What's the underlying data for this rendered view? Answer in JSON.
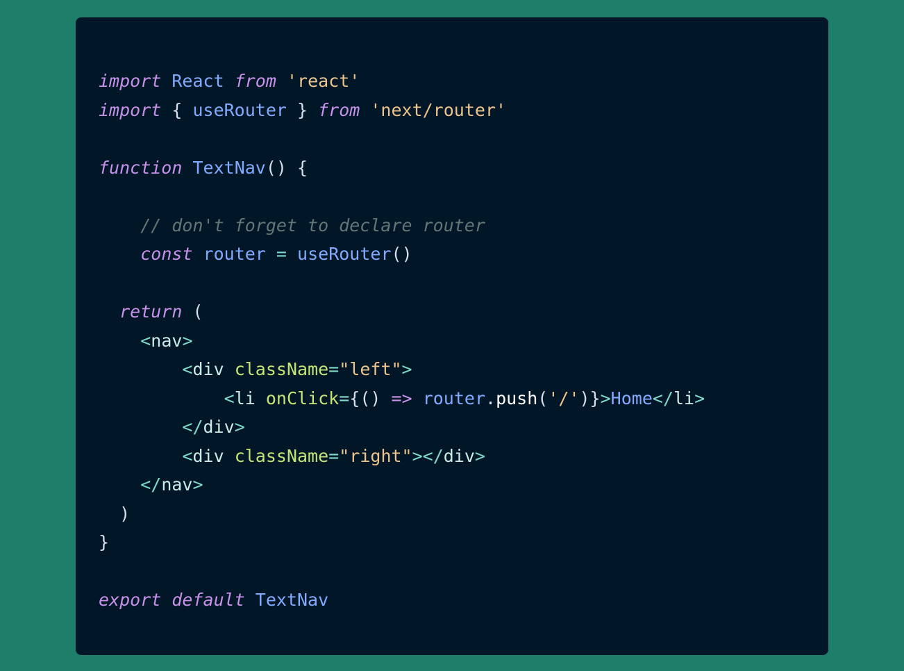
{
  "editor": {
    "lines": [
      {
        "tokens": [
          {
            "text": "import",
            "kind": "keyword"
          },
          {
            "text": " ",
            "kind": "punct"
          },
          {
            "text": "React",
            "kind": "ident"
          },
          {
            "text": " ",
            "kind": "punct"
          },
          {
            "text": "from",
            "kind": "keyword"
          },
          {
            "text": " ",
            "kind": "punct"
          },
          {
            "text": "'react'",
            "kind": "string"
          }
        ]
      },
      {
        "tokens": [
          {
            "text": "import",
            "kind": "keyword"
          },
          {
            "text": " { ",
            "kind": "punct"
          },
          {
            "text": "useRouter",
            "kind": "ident"
          },
          {
            "text": " } ",
            "kind": "punct"
          },
          {
            "text": "from",
            "kind": "keyword"
          },
          {
            "text": " ",
            "kind": "punct"
          },
          {
            "text": "'next/router'",
            "kind": "string"
          }
        ]
      },
      {
        "tokens": []
      },
      {
        "tokens": [
          {
            "text": "function",
            "kind": "keyword"
          },
          {
            "text": " ",
            "kind": "punct"
          },
          {
            "text": "TextNav",
            "kind": "ident"
          },
          {
            "text": "() {",
            "kind": "punct"
          }
        ]
      },
      {
        "tokens": []
      },
      {
        "tokens": [
          {
            "text": "    ",
            "kind": "punct"
          },
          {
            "text": "// don't forget to declare router",
            "kind": "comment"
          }
        ]
      },
      {
        "tokens": [
          {
            "text": "    ",
            "kind": "punct"
          },
          {
            "text": "const",
            "kind": "keyword"
          },
          {
            "text": " ",
            "kind": "punct"
          },
          {
            "text": "router",
            "kind": "ident"
          },
          {
            "text": " ",
            "kind": "punct"
          },
          {
            "text": "=",
            "kind": "tag"
          },
          {
            "text": " ",
            "kind": "punct"
          },
          {
            "text": "useRouter",
            "kind": "ident"
          },
          {
            "text": "()",
            "kind": "punct"
          }
        ]
      },
      {
        "tokens": []
      },
      {
        "tokens": [
          {
            "text": "  ",
            "kind": "punct"
          },
          {
            "text": "return",
            "kind": "keyword"
          },
          {
            "text": " (",
            "kind": "punct"
          }
        ]
      },
      {
        "tokens": [
          {
            "text": "    ",
            "kind": "punct"
          },
          {
            "text": "<",
            "kind": "tag"
          },
          {
            "text": "nav",
            "kind": "tagname"
          },
          {
            "text": ">",
            "kind": "tag"
          }
        ]
      },
      {
        "tokens": [
          {
            "text": "        ",
            "kind": "punct"
          },
          {
            "text": "<",
            "kind": "tag"
          },
          {
            "text": "div",
            "kind": "tagname"
          },
          {
            "text": " ",
            "kind": "punct"
          },
          {
            "text": "className",
            "kind": "attr"
          },
          {
            "text": "=",
            "kind": "tag"
          },
          {
            "text": "\"left\"",
            "kind": "string"
          },
          {
            "text": ">",
            "kind": "tag"
          }
        ]
      },
      {
        "tokens": [
          {
            "text": "            ",
            "kind": "punct"
          },
          {
            "text": "<",
            "kind": "tag"
          },
          {
            "text": "li",
            "kind": "tagname"
          },
          {
            "text": " ",
            "kind": "punct"
          },
          {
            "text": "onClick",
            "kind": "attr"
          },
          {
            "text": "=",
            "kind": "tag"
          },
          {
            "text": "{",
            "kind": "punct"
          },
          {
            "text": "()",
            "kind": "punct"
          },
          {
            "text": " ",
            "kind": "punct"
          },
          {
            "text": "=>",
            "kind": "keyword"
          },
          {
            "text": " ",
            "kind": "punct"
          },
          {
            "text": "router",
            "kind": "ident"
          },
          {
            "text": ".",
            "kind": "punct"
          },
          {
            "text": "push",
            "kind": "prop"
          },
          {
            "text": "(",
            "kind": "punct"
          },
          {
            "text": "'/'",
            "kind": "string"
          },
          {
            "text": ")}",
            "kind": "punct"
          },
          {
            "text": ">",
            "kind": "tag"
          },
          {
            "text": "Home",
            "kind": "text"
          },
          {
            "text": "</",
            "kind": "tag"
          },
          {
            "text": "li",
            "kind": "tagname"
          },
          {
            "text": ">",
            "kind": "tag"
          }
        ]
      },
      {
        "tokens": [
          {
            "text": "        ",
            "kind": "punct"
          },
          {
            "text": "</",
            "kind": "tag"
          },
          {
            "text": "div",
            "kind": "tagname"
          },
          {
            "text": ">",
            "kind": "tag"
          }
        ]
      },
      {
        "tokens": [
          {
            "text": "        ",
            "kind": "punct"
          },
          {
            "text": "<",
            "kind": "tag"
          },
          {
            "text": "div",
            "kind": "tagname"
          },
          {
            "text": " ",
            "kind": "punct"
          },
          {
            "text": "className",
            "kind": "attr"
          },
          {
            "text": "=",
            "kind": "tag"
          },
          {
            "text": "\"right\"",
            "kind": "string"
          },
          {
            "text": "></",
            "kind": "tag"
          },
          {
            "text": "div",
            "kind": "tagname"
          },
          {
            "text": ">",
            "kind": "tag"
          }
        ]
      },
      {
        "tokens": [
          {
            "text": "    ",
            "kind": "punct"
          },
          {
            "text": "</",
            "kind": "tag"
          },
          {
            "text": "nav",
            "kind": "tagname"
          },
          {
            "text": ">",
            "kind": "tag"
          }
        ]
      },
      {
        "tokens": [
          {
            "text": "  )",
            "kind": "punct"
          }
        ]
      },
      {
        "tokens": [
          {
            "text": "}",
            "kind": "punct"
          }
        ]
      },
      {
        "tokens": []
      },
      {
        "tokens": [
          {
            "text": "export",
            "kind": "keyword"
          },
          {
            "text": " ",
            "kind": "punct"
          },
          {
            "text": "default",
            "kind": "keyword"
          },
          {
            "text": " ",
            "kind": "punct"
          },
          {
            "text": "TextNav",
            "kind": "ident"
          }
        ]
      }
    ]
  },
  "colors": {
    "page_background": "#1f7e6a",
    "editor_background": "#011627",
    "keyword": "#c792ea",
    "identifier": "#82aaff",
    "string": "#ecc48d",
    "comment": "#637777",
    "plain": "#d6deeb"
  }
}
